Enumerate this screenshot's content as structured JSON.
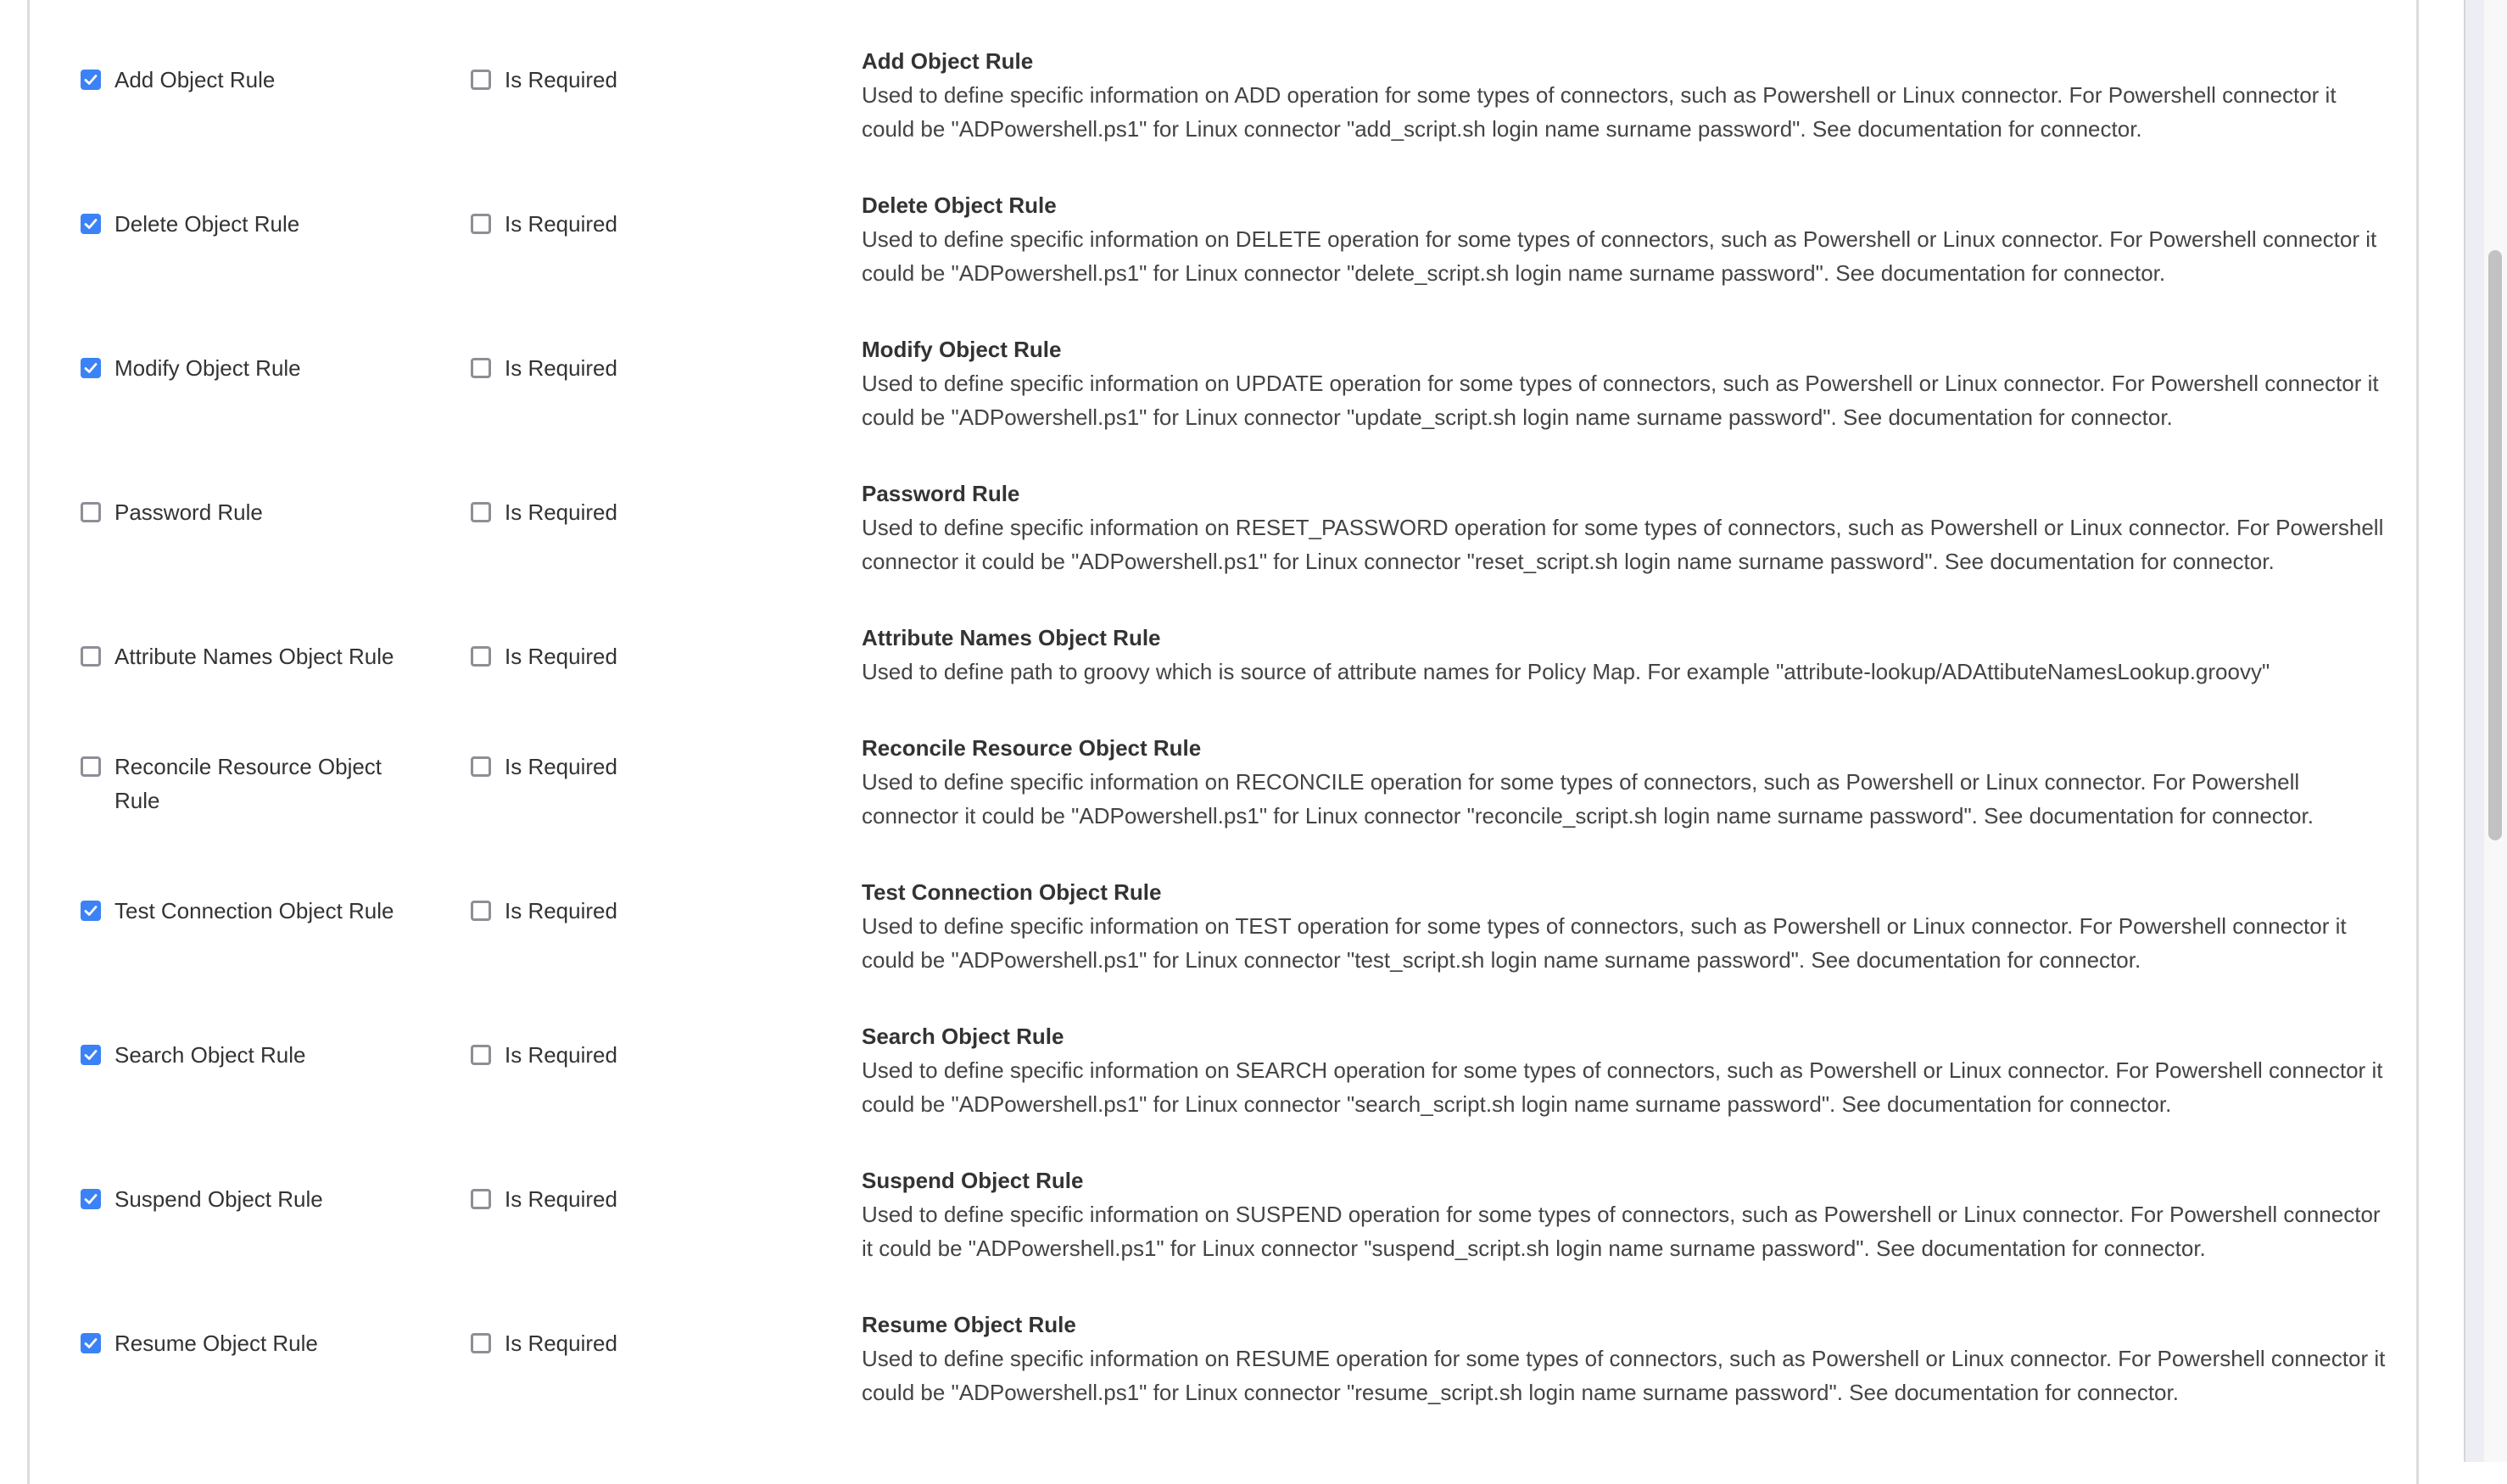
{
  "rules": [
    {
      "label": "Add Object Rule",
      "checked": true,
      "required_label": "Is Required",
      "required": false,
      "title": "Add Object Rule",
      "description": "Used to define specific information on ADD operation for some types of connectors, such as Powershell or Linux connector. For Powershell connector it could be \"ADPowershell.ps1\" for Linux connector \"add_script.sh login name surname password\". See documentation for connector."
    },
    {
      "label": "Delete Object Rule",
      "checked": true,
      "required_label": "Is Required",
      "required": false,
      "title": "Delete Object Rule",
      "description": "Used to define specific information on DELETE operation for some types of connectors, such as Powershell or Linux connector. For Powershell connector it could be \"ADPowershell.ps1\" for Linux connector \"delete_script.sh login name surname password\". See documentation for connector."
    },
    {
      "label": "Modify Object Rule",
      "checked": true,
      "required_label": "Is Required",
      "required": false,
      "title": "Modify Object Rule",
      "description": "Used to define specific information on UPDATE operation for some types of connectors, such as Powershell or Linux connector. For Powershell connector it could be \"ADPowershell.ps1\" for Linux connector \"update_script.sh login name surname password\". See documentation for connector."
    },
    {
      "label": "Password Rule",
      "checked": false,
      "required_label": "Is Required",
      "required": false,
      "title": "Password Rule",
      "description": "Used to define specific information on RESET_PASSWORD operation for some types of connectors, such as Powershell or Linux connector. For Powershell connector it could be \"ADPowershell.ps1\" for Linux connector \"reset_script.sh login name surname password\". See documentation for connector."
    },
    {
      "label": "Attribute Names Object Rule",
      "checked": false,
      "required_label": "Is Required",
      "required": false,
      "title": "Attribute Names Object Rule",
      "description": "Used to define path to groovy which is source of attribute names for Policy Map. For example \"attribute-lookup/ADAttibuteNamesLookup.groovy\""
    },
    {
      "label": "Reconcile Resource Object Rule",
      "checked": false,
      "required_label": "Is Required",
      "required": false,
      "title": "Reconcile Resource Object Rule",
      "description": "Used to define specific information on RECONCILE operation for some types of connectors, such as Powershell or Linux connector. For Powershell connector it could be \"ADPowershell.ps1\" for Linux connector \"reconcile_script.sh login name surname password\". See documentation for connector."
    },
    {
      "label": "Test Connection Object Rule",
      "checked": true,
      "required_label": "Is Required",
      "required": false,
      "title": "Test Connection Object Rule",
      "description": "Used to define specific information on TEST operation for some types of connectors, such as Powershell or Linux connector. For Powershell connector it could be \"ADPowershell.ps1\" for Linux connector \"test_script.sh login name surname password\". See documentation for connector."
    },
    {
      "label": "Search Object Rule",
      "checked": true,
      "required_label": "Is Required",
      "required": false,
      "title": "Search Object Rule",
      "description": "Used to define specific information on SEARCH operation for some types of connectors, such as Powershell or Linux connector. For Powershell connector it could be \"ADPowershell.ps1\" for Linux connector \"search_script.sh login name surname password\". See documentation for connector."
    },
    {
      "label": "Suspend Object Rule",
      "checked": true,
      "required_label": "Is Required",
      "required": false,
      "title": "Suspend Object Rule",
      "description": "Used to define specific information on SUSPEND operation for some types of connectors, such as Powershell or Linux connector. For Powershell connector it could be \"ADPowershell.ps1\" for Linux connector \"suspend_script.sh login name surname password\". See documentation for connector."
    },
    {
      "label": "Resume Object Rule",
      "checked": true,
      "required_label": "Is Required",
      "required": false,
      "title": "Resume Object Rule",
      "description": "Used to define specific information on RESUME operation for some types of connectors, such as Powershell or Linux connector. For Powershell connector it could be \"ADPowershell.ps1\" for Linux connector \"resume_script.sh login name surname password\". See documentation for connector."
    }
  ],
  "colors": {
    "checkbox_checked": "#3b82f6",
    "checkbox_unchecked_border": "#8e8e96",
    "text": "#333333"
  }
}
